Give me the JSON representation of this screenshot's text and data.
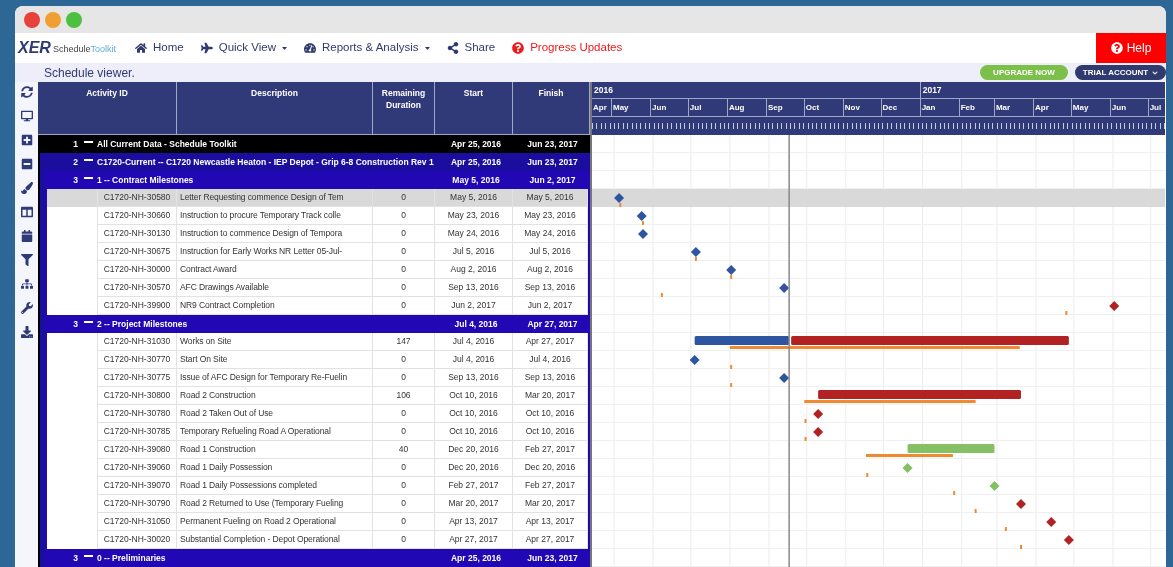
{
  "nav": {
    "logo": {
      "mark": "XER",
      "word_1": "Schedule",
      "word_2": "Toolkit"
    },
    "items": [
      {
        "label": "Home",
        "dropdown": false,
        "alert": false
      },
      {
        "label": "Quick View",
        "dropdown": true,
        "alert": false
      },
      {
        "label": "Reports & Analysis",
        "dropdown": true,
        "alert": false
      },
      {
        "label": "Share",
        "dropdown": false,
        "alert": false
      },
      {
        "label": "Progress Updates",
        "dropdown": false,
        "alert": true
      }
    ],
    "help": "Help"
  },
  "toolbar": {
    "title": "Schedule viewer.",
    "upgrade": "UPGRADE NOW",
    "account": "TRIAL ACCOUNT"
  },
  "table": {
    "columns": [
      "Activity ID",
      "Description",
      "Remaining Duration",
      "Start",
      "Finish"
    ],
    "groups": [
      {
        "kind": "group",
        "level": "1",
        "name": "All Current Data - Schedule Toolkit",
        "start": "Apr 25, 2016",
        "finish": "Jun 23, 2017",
        "expanded": true,
        "children": [
          {
            "kind": "group",
            "level": "2",
            "name": "C1720-Current -- C1720 Newcastle Heaton - IEP Depot - Grip 6-8 Construction Rev 1",
            "start": "Apr 25, 2016",
            "finish": "Jun 23, 2017",
            "expanded": true,
            "children": [
              {
                "kind": "group",
                "level": "3",
                "name": "1 -- Contract Milestones",
                "start": "May 5, 2016",
                "finish": "Jun 2, 2017",
                "expanded": true,
                "children": [
                  {
                    "kind": "milestone",
                    "id": "C1720-NH-30580",
                    "description": "Letter Requesting commence Design of Tem",
                    "remaining": "0",
                    "start": "May 5, 2016",
                    "finish": "May 5, 2016",
                    "color": "#2e56a0",
                    "selected": true
                  },
                  {
                    "kind": "milestone",
                    "id": "C1720-NH-30660",
                    "description": "Instruction to procure Temporary Track colle",
                    "remaining": "0",
                    "start": "May 23, 2016",
                    "finish": "May 23, 2016",
                    "color": "#2e56a0",
                    "selected": false
                  },
                  {
                    "kind": "milestone",
                    "id": "C1720-NH-30130",
                    "description": "Instruction to commence Design of Tempora",
                    "remaining": "0",
                    "start": "May 24, 2016",
                    "finish": "May 24, 2016",
                    "color": "#2e56a0",
                    "selected": false
                  },
                  {
                    "kind": "milestone",
                    "id": "C1720-NH-30675",
                    "description": "Instruction for Early Works NR Letter 05-Jul-",
                    "remaining": "0",
                    "start": "Jul 5, 2016",
                    "finish": "Jul 5, 2016",
                    "color": "#2e56a0",
                    "selected": false
                  },
                  {
                    "kind": "milestone",
                    "id": "C1720-NH-30000",
                    "description": "Contract Award",
                    "remaining": "0",
                    "start": "Aug 2, 2016",
                    "finish": "Aug 2, 2016",
                    "color": "#2e56a0",
                    "selected": false
                  },
                  {
                    "kind": "milestone",
                    "id": "C1720-NH-30570",
                    "description": "AFC Drawings Available",
                    "remaining": "0",
                    "start": "Sep 13, 2016",
                    "finish": "Sep 13, 2016",
                    "color": "#2e56a0",
                    "selected": false
                  },
                  {
                    "kind": "milestone",
                    "id": "C1720-NH-39900",
                    "description": "NR9 Contract Completion",
                    "remaining": "0",
                    "start": "Jun 2, 2017",
                    "finish": "Jun 2, 2017",
                    "color": "#b22222",
                    "selected": false
                  }
                ]
              },
              {
                "kind": "group",
                "level": "3",
                "name": "2 -- Project Milestones",
                "start": "Jul 4, 2016",
                "finish": "Apr 27, 2017",
                "expanded": true,
                "children": [
                  {
                    "kind": "task",
                    "id": "C1720-NH-31030",
                    "description": "Works on Site",
                    "remaining": "147",
                    "start": "Jul 4, 2016",
                    "finish": "Apr 27, 2017",
                    "color": "#b22222",
                    "selected": false
                  },
                  {
                    "kind": "milestone",
                    "id": "C1720-NH-30770",
                    "description": "Start On Site",
                    "remaining": "0",
                    "start": "Jul 4, 2016",
                    "finish": "Jul 4, 2016",
                    "color": "#2e56a0",
                    "selected": false
                  },
                  {
                    "kind": "milestone",
                    "id": "C1720-NH-30775",
                    "description": "Issue of AFC Design for Temporary Re-Fuelin",
                    "remaining": "0",
                    "start": "Sep 13, 2016",
                    "finish": "Sep 13, 2016",
                    "color": "#2e56a0",
                    "selected": false
                  },
                  {
                    "kind": "task",
                    "id": "C1720-NH-30800",
                    "description": "Road 2 Construction",
                    "remaining": "106",
                    "start": "Oct 10, 2016",
                    "finish": "Mar 20, 2017",
                    "color": "#b22222",
                    "selected": false
                  },
                  {
                    "kind": "milestone",
                    "id": "C1720-NH-30780",
                    "description": "Road 2 Taken Out of Use",
                    "remaining": "0",
                    "start": "Oct 10, 2016",
                    "finish": "Oct 10, 2016",
                    "color": "#b22222",
                    "selected": false
                  },
                  {
                    "kind": "milestone",
                    "id": "C1720-NH-30785",
                    "description": "Temporary Refueling Road A Operational",
                    "remaining": "0",
                    "start": "Oct 10, 2016",
                    "finish": "Oct 10, 2016",
                    "color": "#b22222",
                    "selected": false
                  },
                  {
                    "kind": "task",
                    "id": "C1720-NH-39080",
                    "description": "Road 1 Construction",
                    "remaining": "40",
                    "start": "Dec 20, 2016",
                    "finish": "Feb 27, 2017",
                    "color": "#86c064",
                    "selected": false
                  },
                  {
                    "kind": "milestone",
                    "id": "C1720-NH-39060",
                    "description": "Road 1 Daily Possession",
                    "remaining": "0",
                    "start": "Dec 20, 2016",
                    "finish": "Dec 20, 2016",
                    "color": "#86c064",
                    "selected": false
                  },
                  {
                    "kind": "milestone",
                    "id": "C1720-NH-39070",
                    "description": "Road 1 Daily Possessions completed",
                    "remaining": "0",
                    "start": "Feb 27, 2017",
                    "finish": "Feb 27, 2017",
                    "color": "#86c064",
                    "selected": false
                  },
                  {
                    "kind": "milestone",
                    "id": "C1720-NH-30790",
                    "description": "Road 2 Returned to Use (Temporary Fueling",
                    "remaining": "0",
                    "start": "Mar 20, 2017",
                    "finish": "Mar 20, 2017",
                    "color": "#b22222",
                    "selected": false
                  },
                  {
                    "kind": "milestone",
                    "id": "C1720-NH-31050",
                    "description": "Permanent Fueling on Road 2 Operational",
                    "remaining": "0",
                    "start": "Apr 13, 2017",
                    "finish": "Apr 13, 2017",
                    "color": "#b22222",
                    "selected": false
                  },
                  {
                    "kind": "milestone",
                    "id": "C1720-NH-30020",
                    "description": "Substantial Completion - Depot Operational",
                    "remaining": "0",
                    "start": "Apr 27, 2017",
                    "finish": "Apr 27, 2017",
                    "color": "#b22222",
                    "selected": false
                  }
                ]
              },
              {
                "kind": "group",
                "level": "3",
                "name": "0 -- Preliminaries",
                "start": "Apr 25, 2016",
                "finish": "Jun 23, 2017",
                "expanded": true
              }
            ]
          }
        ]
      }
    ]
  },
  "gantt": {
    "years": [
      "2016",
      "2017"
    ],
    "months": [
      "Apr",
      "May",
      "Jun",
      "Jul",
      "Aug",
      "Sep",
      "Oct",
      "Nov",
      "Dec",
      "Jan",
      "Feb",
      "Mar",
      "Apr",
      "May",
      "Jun",
      "Jul"
    ]
  }
}
